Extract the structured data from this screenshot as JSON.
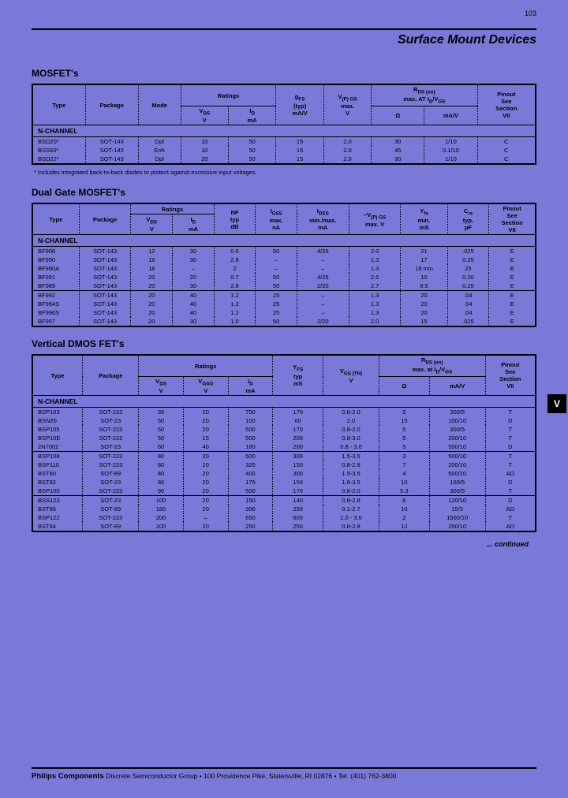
{
  "page_number": "103",
  "main_title": "Surface Mount Devices",
  "side_tab": "V",
  "footnote_mosfet": "* Includes integrated back-to-back diodes to protect against excessive input voltages.",
  "continued": "... continued",
  "footer_company": "Philips Components",
  "footer_rest": "Discrete Semiconductor Group • 100 Providence Pike, Slatersville, RI 02876 • Tel. (401) 762-3800",
  "mosfet": {
    "title": "MOSFET's",
    "headers": {
      "type": "Type",
      "package": "Package",
      "mode": "Mode",
      "ratings": "Ratings",
      "vds": "V<sub>DS</sub><br>V",
      "id": "I<sub>D</sub><br>mA",
      "gfs": "g<sub>FS</sub><br>(typ)<br>mA/V",
      "vpgs": "V<sub>(P) GS</sub><br>max.<br>V",
      "rds": "R<sub>DS (on)</sub><br>max. AT I<sub>D</sub>/V<sub>GS</sub>",
      "ohm": "Ω",
      "mav": "mA/V",
      "pinout": "Pinout<br>See<br>Section<br>VII"
    },
    "channel": "N-CHANNEL",
    "rows": [
      [
        "BSD20*",
        "SOT-143",
        "Dpl",
        "10",
        "50",
        "15",
        "2.0",
        "30",
        "1/10",
        "C"
      ],
      [
        "BSS83*",
        "SOT-143",
        "Enh",
        "10",
        "50",
        "15",
        "2.0",
        "45",
        "0.1/10",
        "C"
      ],
      [
        "BSD22*",
        "SOT-143",
        "Dpl",
        "20",
        "50",
        "15",
        "2.0",
        "30",
        "1/10",
        "C"
      ]
    ]
  },
  "dualgate": {
    "title": "Dual Gate MOSFET's",
    "headers": {
      "type": "Type",
      "package": "Package",
      "ratings": "Ratings",
      "vds": "V<sub>DS</sub><br>V",
      "id": "I<sub>D</sub><br>mA",
      "nf": "NF<br>typ<br>dB",
      "igss": "I<sub>GSS</sub><br>max.<br>nA",
      "idss": "I<sub>DSS</sub><br>min./max.<br>mA",
      "vpgs": "−V<sub>(P) GS</sub><br>max. V",
      "yfs": "Y<sub>fs</sub><br>min.<br>mS",
      "crs": "C<sub>rs</sub><br>typ.<br>pF",
      "pinout": "Pinout<br>See<br>Section<br>VII"
    },
    "channel": "N-CHANNEL",
    "group1": [
      [
        "BF908",
        "SOT-143",
        "12",
        "30",
        "0.6",
        "50",
        "4/20",
        "2.0",
        "21",
        ".025",
        "E"
      ],
      [
        "BF990",
        "SOT-143",
        "18",
        "30",
        "2.8",
        "–",
        "–",
        "1.3",
        "17",
        "0.25",
        "E"
      ],
      [
        "BF990A",
        "SOT-143",
        "18",
        "–",
        "2",
        "–",
        "–",
        "1.3",
        "18 min",
        "25",
        "E"
      ],
      [
        "BF991",
        "SOT-143",
        "20",
        "20",
        "0.7",
        "50",
        "4/25",
        "2.5",
        "10",
        "0.20",
        "E"
      ],
      [
        "BF989",
        "SOT-143",
        "20",
        "30",
        "2.8",
        "50",
        "2/20",
        "2.7",
        "9.5",
        "0.25",
        "E"
      ]
    ],
    "group2": [
      [
        "BF992",
        "SOT-143",
        "20",
        "40",
        "1.2",
        "25",
        "–",
        "1.3",
        "20",
        ".04",
        "E"
      ],
      [
        "BF994S",
        "SOT-143",
        "20",
        "40",
        "1.2",
        "25",
        "–",
        "1.3",
        "20",
        ".04",
        "E"
      ],
      [
        "BF996S",
        "SOT-143",
        "20",
        "40",
        "1.2",
        "25",
        "–",
        "1.3",
        "20",
        ".04",
        "E"
      ],
      [
        "BF997",
        "SOT-143",
        "20",
        "30",
        "1.0",
        "50",
        "2/20",
        "2.0",
        "15",
        ".025",
        "E"
      ]
    ]
  },
  "vdmos": {
    "title": "Vertical DMOS FET's",
    "headers": {
      "type": "Type",
      "package": "Package",
      "ratings": "Ratings",
      "vds": "V<sub>DS</sub><br>V",
      "vgso": "V<sub>GSO</sub><br>V",
      "id": "I<sub>D</sub><br>mA",
      "yfs": "Y<sub>FS</sub><br>typ<br>mS",
      "vgsth": "V<sub>GS (TH)</sub><br>V",
      "rds": "R<sub>DS (on)</sub><br>max. at I<sub>D</sub>/V<sub>GS</sub>",
      "ohm": "Ω",
      "mav": "mA/V",
      "pinout": "Pinout<br>See<br>Section<br>VII"
    },
    "channel": "N-CHANNEL",
    "group1": [
      [
        "BSP103",
        "SOT-223",
        "35",
        "20",
        "750",
        "170",
        "0.8-2.0",
        "5",
        "300/5",
        "T"
      ],
      [
        "BSN20",
        "SOT-23",
        "50",
        "20",
        "100",
        "60",
        "2.0",
        "15",
        "100/10",
        "D"
      ],
      [
        "BSP105",
        "SOT-223",
        "50",
        "20",
        "500",
        "170",
        "0.8-2.0",
        "5",
        "300/5",
        "T"
      ],
      [
        "BSP10E",
        "SOT-223",
        "50",
        "15",
        "500",
        "200",
        "0.8-3.0",
        "5",
        "200/10",
        "T"
      ],
      [
        "2N7002",
        "SOT-23",
        "60",
        "40",
        "180",
        "200",
        "0.8 - 3.0",
        "5",
        "500/10",
        "D"
      ]
    ],
    "group2": [
      [
        "BSP108",
        "SOT-223",
        "80",
        "20",
        "500",
        "300",
        "1.5-3.5",
        "3",
        "500/10",
        "T"
      ],
      [
        "BSP110",
        "SOT-223",
        "80",
        "20",
        "325",
        "150",
        "0.8-2.8",
        "7",
        "200/10",
        "T"
      ],
      [
        "BST80",
        "SOT-89",
        "80",
        "20",
        "400",
        "300",
        "1.5-3.5",
        "4",
        "500/10",
        "AD"
      ],
      [
        "BST82",
        "SOT-23",
        "80",
        "20",
        "175",
        "150",
        "1.6-3.5",
        "10",
        "150/5",
        "D"
      ],
      [
        "BSP100",
        "SOT-223",
        "90",
        "20",
        "500",
        "170",
        "0.8-2.0",
        "5.3",
        "300/5",
        "T"
      ]
    ],
    "group3": [
      [
        "BSS123",
        "SOT-23",
        "100",
        "20",
        "150",
        "140",
        "0.8-2.8",
        "6",
        "120/10",
        "D"
      ],
      [
        "BST86",
        "SOT-89",
        "180",
        "20",
        "300",
        "250",
        "0.1-2.7",
        "10",
        "15/3",
        "AD"
      ],
      [
        "BSP122",
        "SOT-223",
        "200",
        "–",
        "650",
        "600",
        "1.0 - 3.0",
        "2",
        "1500/10",
        "T"
      ],
      [
        "BST84",
        "SOT-89",
        "200",
        "20",
        "250",
        "250",
        "0.8-2.8",
        "12",
        "250/10",
        "AD"
      ]
    ]
  }
}
